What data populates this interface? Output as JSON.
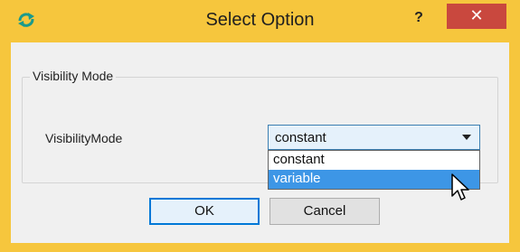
{
  "window": {
    "title": "Select Option",
    "help_label": "?",
    "close_label": "✕",
    "app_icon": "refresh-arrows-icon",
    "titlebar_color": "#f6c63d",
    "close_color": "#c9483e"
  },
  "group": {
    "title": "Visibility Mode"
  },
  "field": {
    "label": "VisibilityMode",
    "selected_value": "constant",
    "options": [
      "constant",
      "variable"
    ],
    "highlighted_option": "variable",
    "highlight_color": "#3d96e6"
  },
  "buttons": {
    "ok_label": "OK",
    "cancel_label": "Cancel"
  }
}
